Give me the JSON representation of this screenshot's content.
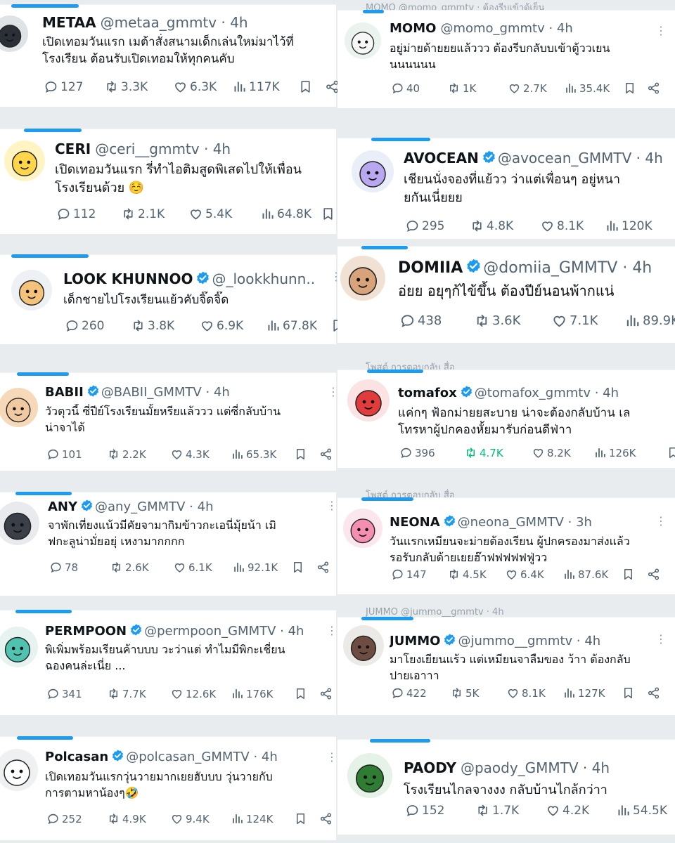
{
  "colors": {
    "accent": "#1d9bf0",
    "muted": "#536471",
    "text": "#0f1419",
    "retweet_active": "#00ba7c"
  },
  "tweets": [
    {
      "name": "METAA",
      "handle": "@metaa_gmmtv",
      "time": "4h",
      "verified": false,
      "text": "เปิดเทอมวันแรก เมต้าสั่งสนามเด็กเล่นใหม่มาไว้ที่\nโรงเรียน ต้อนรับเปิดเทอมให้ทุกคนคับ",
      "replies": "127",
      "retweets": "3.3K",
      "likes": "6.3K",
      "views": "117K",
      "avatar_icon": "metaa-bunny-icon",
      "avatar_bg": "#dfe3e6"
    },
    {
      "name": "CERI",
      "handle": "@ceri__gmmtv",
      "time": "4h",
      "verified": false,
      "text": "เปิดเทอมวันแรก รี่ทำไอติมสูดพิเสดไปให้เพื่อน\nโรงเรียนด้วย ☺️",
      "replies": "112",
      "retweets": "2.1K",
      "likes": "5.4K",
      "views": "64.8K",
      "avatar_icon": "ceri-star-icon",
      "avatar_bg": "#fff4c2"
    },
    {
      "name": "LOOK KHUNNOO",
      "handle": "@_lookkhunn...",
      "time": "",
      "verified": true,
      "text": "เด็กชายไปโรงเรียนแย้วคับจิ๊ดจิ๊ด",
      "replies": "260",
      "retweets": "3.8K",
      "likes": "6.9K",
      "views": "67.8K",
      "avatar_icon": "lookkhunnoo-tiger-icon",
      "avatar_bg": "#eef1f3"
    },
    {
      "name": "BABII",
      "handle": "@BABII_GMMTV",
      "time": "4h",
      "verified": true,
      "text": "วัวตุวนี้ ซี่ปีย์โรงเรียนมั้ยหรียแล้ววว แต่ซี่กลับบ้าน\nน่าจาได้",
      "replies": "101",
      "retweets": "2.2K",
      "likes": "4.3K",
      "views": "65.3K",
      "avatar_icon": "babii-face-icon",
      "avatar_bg": "#f5d9b8"
    },
    {
      "name": "ANY",
      "handle": "@any_GMMTV",
      "time": "4h",
      "verified": true,
      "text": "จาพักเที่ยงแน้วมีคัยจามากิมข้าวกะเอนี่มุ้ยน้า เมิ\nฟกะลูน่ามั่ยอยุ่ เหงามากกกก",
      "replies": "78",
      "retweets": "2.6K",
      "likes": "6.1K",
      "views": "92.1K",
      "avatar_icon": "any-face-icon",
      "avatar_bg": "#e8eaed"
    },
    {
      "name": "PERMPOON",
      "handle": "@permpoon_GMMTV",
      "time": "4h",
      "verified": true,
      "text": "พิเพิ่มพร้อมเรียนค้าบบบ วะว่าแต่ ทำไมมีพิกะเชี่ยน\nฉองคนล่ะเนี่ย ...",
      "replies": "341",
      "retweets": "7.7K",
      "likes": "12.6K",
      "views": "176K",
      "avatar_icon": "permpoon-bear-icon",
      "avatar_bg": "#e6f3f1"
    },
    {
      "name": "Polcasan",
      "handle": "@polcasan_GMMTV",
      "time": "4h",
      "verified": true,
      "text": "เปิดเทอมวันแรกวุ่นวายมากเยยฮับบบ วุ่นวายกับ\nการตามหาน้องๆ🤣",
      "replies": "252",
      "retweets": "4.9K",
      "likes": "9.4K",
      "views": "124K",
      "avatar_icon": "polcasan-ghost-icon",
      "avatar_bg": "#eef0f2"
    },
    {
      "name": "MOMO",
      "handle": "@momo_gmmtv",
      "time": "4h",
      "verified": false,
      "text": "อยู่ม่ายด้ายยยแล้ววว ต้องรีบกลับบเข้าตู้ววเยน\nนนนนนน",
      "replies": "40",
      "retweets": "1K",
      "likes": "2.7K",
      "views": "35.4K",
      "avatar_icon": "momo-snowman-icon",
      "avatar_bg": "#eaf3ee"
    },
    {
      "name": "AVOCEAN",
      "handle": "@avocean_GMMTV",
      "time": "4h",
      "verified": true,
      "text": "เชียนนั่งจองที่แย้วว ว่าแต่เพื่อนๆ อยู่หนา\nยกันเนี่ยยย",
      "replies": "295",
      "retweets": "4.8K",
      "likes": "8.1K",
      "views": "120K",
      "avatar_icon": "avocean-unicorn-icon",
      "avatar_bg": "#e9eef8"
    },
    {
      "name": "DOMIIA",
      "handle": "@domiia_GMMTV",
      "time": "4h",
      "verified": true,
      "text": "อ่ยย อยุๆก้ไข้ขึ้น ต้องปีย์นอนพ้ากแน่",
      "replies": "438",
      "retweets": "3.6K",
      "likes": "7.1K",
      "views": "89.9K",
      "avatar_icon": "domiia-devil-icon",
      "avatar_bg": "#f1e1d3"
    },
    {
      "name": "tomafox",
      "handle": "@tomafox_gmmtv",
      "time": "4h",
      "verified": true,
      "text": "แค่กๆ ฟ้อกม่ายยสะบาย น่าจะต้องกลับบ้าน เล\nโทรหาผู้ปกคองหั้ยมารับก่อนดีฟ่าา",
      "replies": "396",
      "retweets": "4.7K",
      "likes": "8.2K",
      "views": "126K",
      "retweet_active": true,
      "avatar_icon": "tomafox-fox-icon",
      "avatar_bg": "#fbe3e3"
    },
    {
      "name": "NEONA",
      "handle": "@neona_GMMTV",
      "time": "3h",
      "verified": true,
      "text": "วันแรกเหมียนจะม่ายต้องเรียน ผู้ปกครองมาส่งแล้ว\nรอรับกลับด้ายเยยฮ๊าฟฟฟฟฟฟู่วว",
      "replies": "147",
      "retweets": "4.5K",
      "likes": "6.4K",
      "views": "87.6K",
      "avatar_icon": "neona-flower-icon",
      "avatar_bg": "#fbe6ee"
    },
    {
      "name": "JUMMO",
      "handle": "@jummo__gmmtv",
      "time": "4h",
      "verified": true,
      "text": "มาโยงเยียนแร้ว แต่เหมียนจาลืมของ ว้าา ต้องกลับ\nปายเอาาา",
      "replies": "422",
      "retweets": "5K",
      "likes": "8.1K",
      "views": "127K",
      "avatar_icon": "jummo-face-icon",
      "avatar_bg": "#eceae6"
    },
    {
      "name": "PAODY",
      "handle": "@paody_GMMTV",
      "time": "4h",
      "verified": false,
      "text": "โรงเรียนไกลจางงง กลับบ้านไกล้กว่าา",
      "replies": "152",
      "retweets": "1.7K",
      "likes": "4.2K",
      "views": "54.5K",
      "avatar_icon": "paody-boy-icon",
      "avatar_bg": "#e5f2e8"
    }
  ],
  "ghost_rows": [
    "MOMO @momo_gmmtv · ต้องรีบเข้าตู้เย็น",
    "ตอบกลับ",
    "โพสต์   การตอบกลับ   สื่อ",
    "โพสต์   การตอบกลับ   สื่อ",
    "JUMMO @jummo__gmmtv · 4h"
  ]
}
